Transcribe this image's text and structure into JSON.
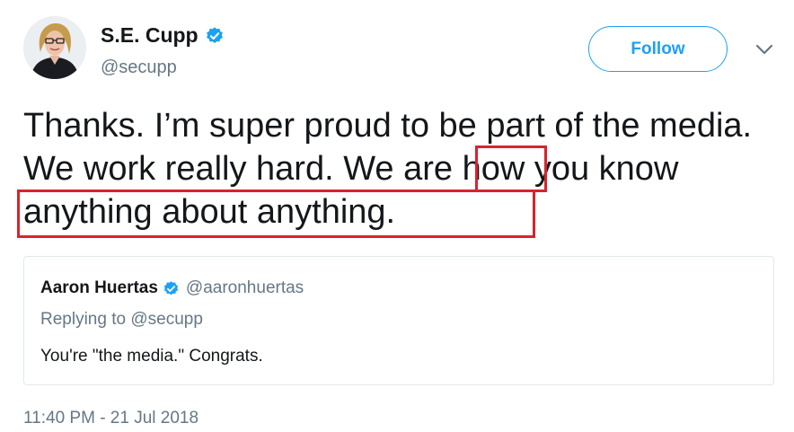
{
  "author": {
    "display_name": "S.E. Cupp",
    "handle": "@secupp",
    "verified": true
  },
  "follow_button": {
    "label": "Follow"
  },
  "menu": {
    "icon": "chevron-down-icon"
  },
  "tweet": {
    "text_before_box": "Thanks. I’m super proud to be part of the media. We work really hard. ",
    "text_boxed_1": "We",
    "text_between": " are how you ",
    "text_boxed_2": "know anything about anything.",
    "highlight_color": "#d9232d"
  },
  "quoted_tweet": {
    "display_name": "Aaron Huertas",
    "handle": "@aaronhuertas",
    "verified": true,
    "replying_prefix": "Replying to ",
    "replying_to": "@secupp",
    "text": "You're \"the media.\" Congrats."
  },
  "timestamp": "11:40 PM - 21 Jul 2018",
  "colors": {
    "accent": "#1da1f2",
    "text": "#14171a",
    "secondary": "#657786",
    "border": "#e1e8ed"
  }
}
